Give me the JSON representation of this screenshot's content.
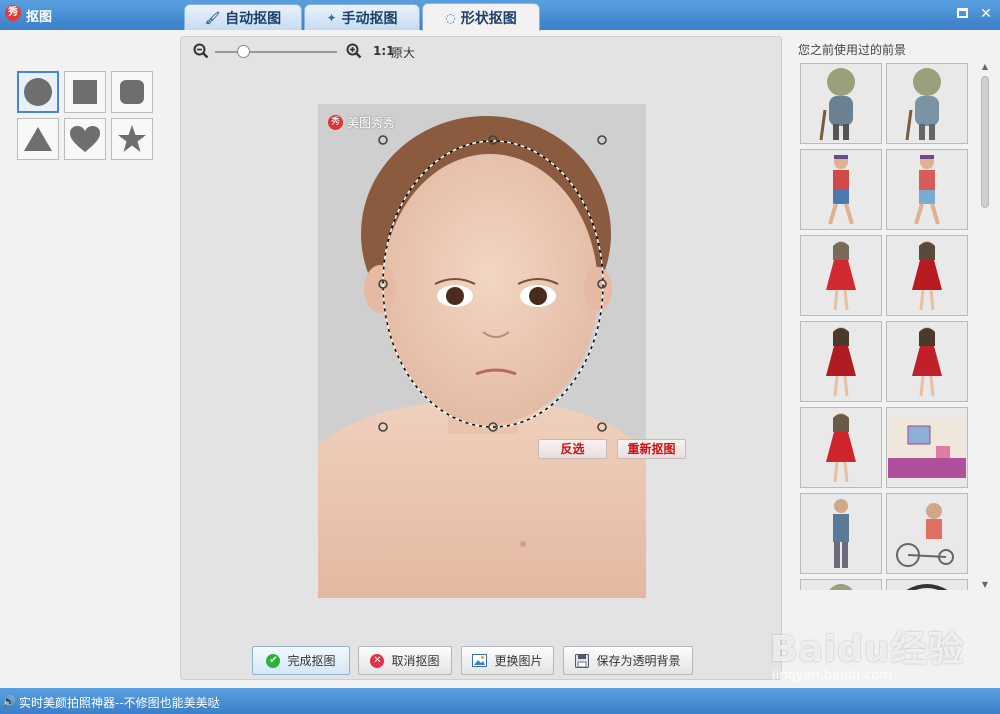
{
  "window": {
    "title": "抠图",
    "logo_char": "秀",
    "maximize_label": "",
    "close_label": "✕"
  },
  "tabs": [
    {
      "label": "自动抠图",
      "icon": "brush-icon",
      "active": false
    },
    {
      "label": "手动抠图",
      "icon": "wand-icon",
      "active": false
    },
    {
      "label": "形状抠图",
      "icon": "lasso-icon",
      "active": true
    }
  ],
  "shapes": [
    {
      "name": "circle",
      "selected": true
    },
    {
      "name": "square",
      "selected": false
    },
    {
      "name": "rounded-square",
      "selected": false
    },
    {
      "name": "triangle",
      "selected": false
    },
    {
      "name": "heart",
      "selected": false
    },
    {
      "name": "star",
      "selected": false
    }
  ],
  "zoom": {
    "ratio": "1:1",
    "ratio_label": "原大",
    "level": 0.2
  },
  "canvas": {
    "watermark_logo": "秀",
    "watermark": "美图秀秀",
    "invert_label": "反选",
    "recut_label": "重新抠图"
  },
  "actions": {
    "finish": "完成抠图",
    "cancel": "取消抠图",
    "change_image": "更换图片",
    "save_transparent": "保存为透明背景"
  },
  "backgrounds": {
    "title": "您之前使用过的前景"
  },
  "status": {
    "text": "实时美颜拍照神器--不修图也能美美哒"
  },
  "brand": {
    "name": "Baidu经验",
    "url": "jingyan.baidu.com"
  },
  "colors": {
    "titlebar": "#3a7fc8",
    "accent_red": "#d01010",
    "selected_border": "#4a86d0"
  }
}
